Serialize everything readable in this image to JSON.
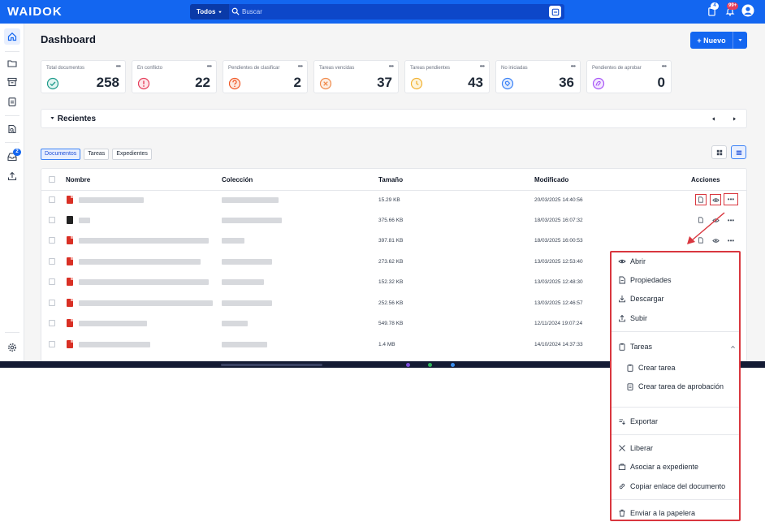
{
  "app": {
    "logo": "WAIDOK",
    "search": {
      "scope": "Todos",
      "placeholder": "Buscar"
    },
    "notifications": {
      "tasks_badge": "4",
      "alerts_badge": "99+"
    }
  },
  "page": {
    "title": "Dashboard",
    "new_button": "+ Nuevo"
  },
  "stats": [
    {
      "label": "Total documentos",
      "value": "258",
      "color": "#1d9a8a",
      "icon": "check-circle-icon"
    },
    {
      "label": "En conflicto",
      "value": "22",
      "color": "#e53e5b",
      "icon": "exclamation-circle-icon"
    },
    {
      "label": "Pendientes de clasificar",
      "value": "2",
      "color": "#f05a28",
      "icon": "question-circle-icon"
    },
    {
      "label": "Tareas vencidas",
      "value": "37",
      "color": "#f08a4b",
      "icon": "x-circle-icon"
    },
    {
      "label": "Tareas pendientes",
      "value": "43",
      "color": "#f2b233",
      "icon": "clock-circle-icon"
    },
    {
      "label": "No iniciadas",
      "value": "36",
      "color": "#3b82f6",
      "icon": "tag-circle-icon"
    },
    {
      "label": "Pendientes de aprobar",
      "value": "0",
      "color": "#a855f7",
      "icon": "approve-circle-icon"
    }
  ],
  "recent": {
    "title": "Recientes"
  },
  "tabs": [
    "Documentos",
    "Tareas",
    "Expedientes"
  ],
  "table": {
    "headers": {
      "name": "Nombre",
      "collection": "Colección",
      "size": "Tamaño",
      "modified": "Modificado",
      "actions": "Acciones"
    },
    "rows": [
      {
        "type": "pdf",
        "size": "15.29 KB",
        "modified": "20/03/2025 14:40:56"
      },
      {
        "type": "dark",
        "size": "375.66 KB",
        "modified": "18/03/2025 16:07:32"
      },
      {
        "type": "pdf",
        "size": "397.81 KB",
        "modified": "18/03/2025 16:00:53"
      },
      {
        "type": "pdf",
        "size": "273.62 KB",
        "modified": "13/03/2025 12:53:40"
      },
      {
        "type": "pdf",
        "size": "152.32 KB",
        "modified": "13/03/2025 12:48:30"
      },
      {
        "type": "pdf",
        "size": "252.56 KB",
        "modified": "13/03/2025 12:46:57"
      },
      {
        "type": "pdf",
        "size": "549.78 KB",
        "modified": "12/11/2024 19:07:24"
      },
      {
        "type": "pdf",
        "size": "1.4 MB",
        "modified": "14/10/2024 14:37:33"
      }
    ]
  },
  "context_menu": {
    "open": "Abrir",
    "properties": "Propiedades",
    "download": "Descargar",
    "upload": "Subir",
    "tasks": "Tareas",
    "create_task": "Crear tarea",
    "create_approval_task": "Crear tarea de aprobación",
    "export": "Exportar",
    "release": "Liberar",
    "link_to_file": "Asociar a expediente",
    "copy_link": "Copiar enlace del documento",
    "trash": "Enviar a la papelera"
  },
  "sidebar": {
    "inbox_badge": "2"
  },
  "colors": {
    "primary": "#1366f0",
    "highlight": "#d9373f"
  }
}
